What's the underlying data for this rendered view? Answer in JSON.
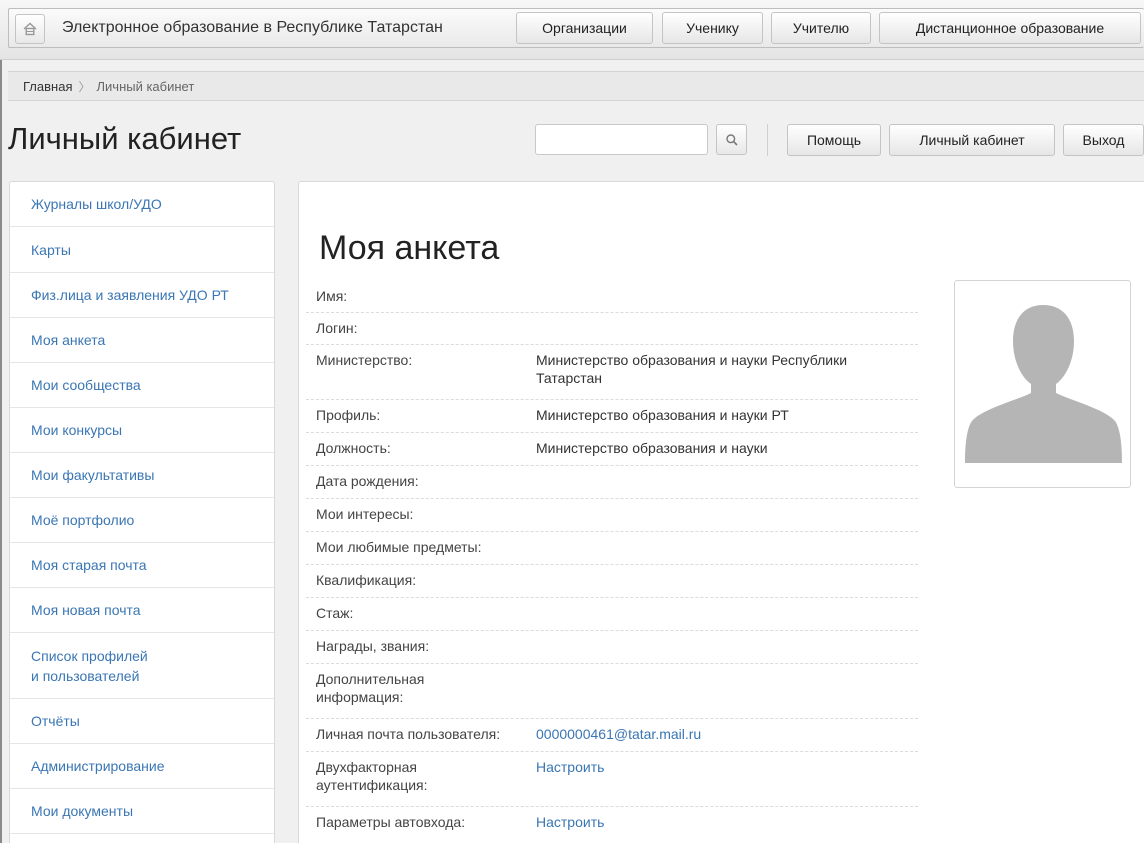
{
  "header": {
    "site_title": "Электронное образование в Республике Татарстан",
    "nav": [
      "Организации",
      "Ученику",
      "Учителю",
      "Дистанционное образование"
    ]
  },
  "breadcrumb": {
    "home": "Главная",
    "separator": "〉",
    "current": "Личный кабинет"
  },
  "page_title": "Личный кабинет",
  "search": {
    "value": "",
    "icon": "search-icon"
  },
  "toolbar": {
    "help": "Помощь",
    "cabinet": "Личный кабинет",
    "logout": "Выход"
  },
  "sidebar": {
    "items": [
      "Журналы школ/УДО",
      "Карты",
      "Физ.лица и заявления УДО РТ",
      "Моя анкета",
      "Мои сообщества",
      "Мои конкурсы",
      "Мои факультативы",
      "Моё портфолио",
      "Моя старая почта",
      "Моя новая почта",
      "Список профилей\nи пользователей",
      "Отчёты",
      "Администрирование",
      "Мои документы"
    ]
  },
  "profile": {
    "title": "Моя анкета",
    "fields": [
      {
        "label": "Имя:",
        "value": ""
      },
      {
        "label": "Логин:",
        "value": ""
      },
      {
        "label": "Министерство:",
        "value": "Министерство образования и науки Республики Татарстан"
      },
      {
        "label": "Профиль:",
        "value": "Министерство образования и науки РТ"
      },
      {
        "label": "Должность:",
        "value": "Министерство образования и науки"
      },
      {
        "label": "Дата рождения:",
        "value": ""
      },
      {
        "label": "Мои интересы:",
        "value": ""
      },
      {
        "label": "Мои любимые предметы:",
        "value": ""
      },
      {
        "label": "Квалификация:",
        "value": ""
      },
      {
        "label": "Стаж:",
        "value": ""
      },
      {
        "label": "Награды, звания:",
        "value": ""
      },
      {
        "label": "Дополнительная информация:",
        "value": ""
      },
      {
        "label": "Личная почта пользователя:",
        "value": "0000000461@tatar.mail.ru"
      },
      {
        "label": "Двухфакторная аутентификация:",
        "value": "Настроить"
      },
      {
        "label": "Параметры автовхода:",
        "value": "Настроить"
      }
    ]
  },
  "colors": {
    "link": "#3a76b4",
    "avatar": "#b5b5b5"
  }
}
